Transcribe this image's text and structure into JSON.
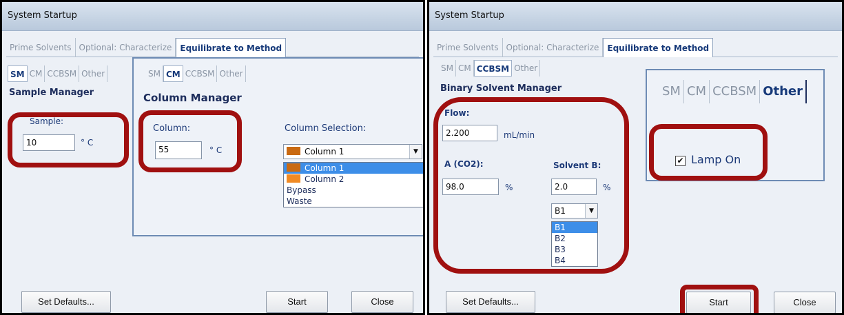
{
  "left": {
    "title": "System Startup",
    "tabs": [
      "Prime Solvents",
      "Optional: Characterize",
      "Equilibrate to Method"
    ],
    "subtabs": [
      "SM",
      "CM",
      "CCBSM",
      "Other"
    ],
    "sample_manager": {
      "heading": "Sample Manager",
      "sample_label": "Sample:",
      "sample_value": "10",
      "unit": "° C"
    },
    "column_popup": {
      "subtabs": [
        "SM",
        "CM",
        "CCBSM",
        "Other"
      ],
      "heading": "Column Manager",
      "column_label": "Column:",
      "column_value": "55",
      "unit": "° C",
      "selection_label": "Column Selection:",
      "selected": "Column 1",
      "options": [
        "Column 1",
        "Column 2",
        "Bypass",
        "Waste"
      ],
      "colors": {
        "column1": "#c96a12",
        "column2": "#f08a24"
      }
    },
    "buttons": {
      "defaults": "Set Defaults...",
      "start": "Start",
      "close": "Close"
    }
  },
  "right": {
    "title": "System Startup",
    "tabs": [
      "Prime Solvents",
      "Optional: Characterize",
      "Equilibrate to Method"
    ],
    "subtabs": [
      "SM",
      "CM",
      "CCBSM",
      "Other"
    ],
    "bsm": {
      "heading": "Binary Solvent Manager",
      "flow_label": "Flow:",
      "flow_value": "2.200",
      "flow_unit": "mL/min",
      "a_label": "A (CO2):",
      "a_value": "98.0",
      "a_unit": "%",
      "b_label": "Solvent B:",
      "b_value": "2.0",
      "b_unit": "%",
      "b_selected": "B1",
      "b_options": [
        "B1",
        "B2",
        "B3",
        "B4"
      ]
    },
    "other_popup": {
      "subtabs": [
        "SM",
        "CM",
        "CCBSM",
        "Other"
      ],
      "lamp_label": "Lamp On",
      "lamp_checked": true
    },
    "buttons": {
      "defaults": "Set Defaults...",
      "start": "Start",
      "close": "Close"
    }
  },
  "colors": {
    "highlight": "#a01010",
    "selection": "#3d8ee8"
  }
}
